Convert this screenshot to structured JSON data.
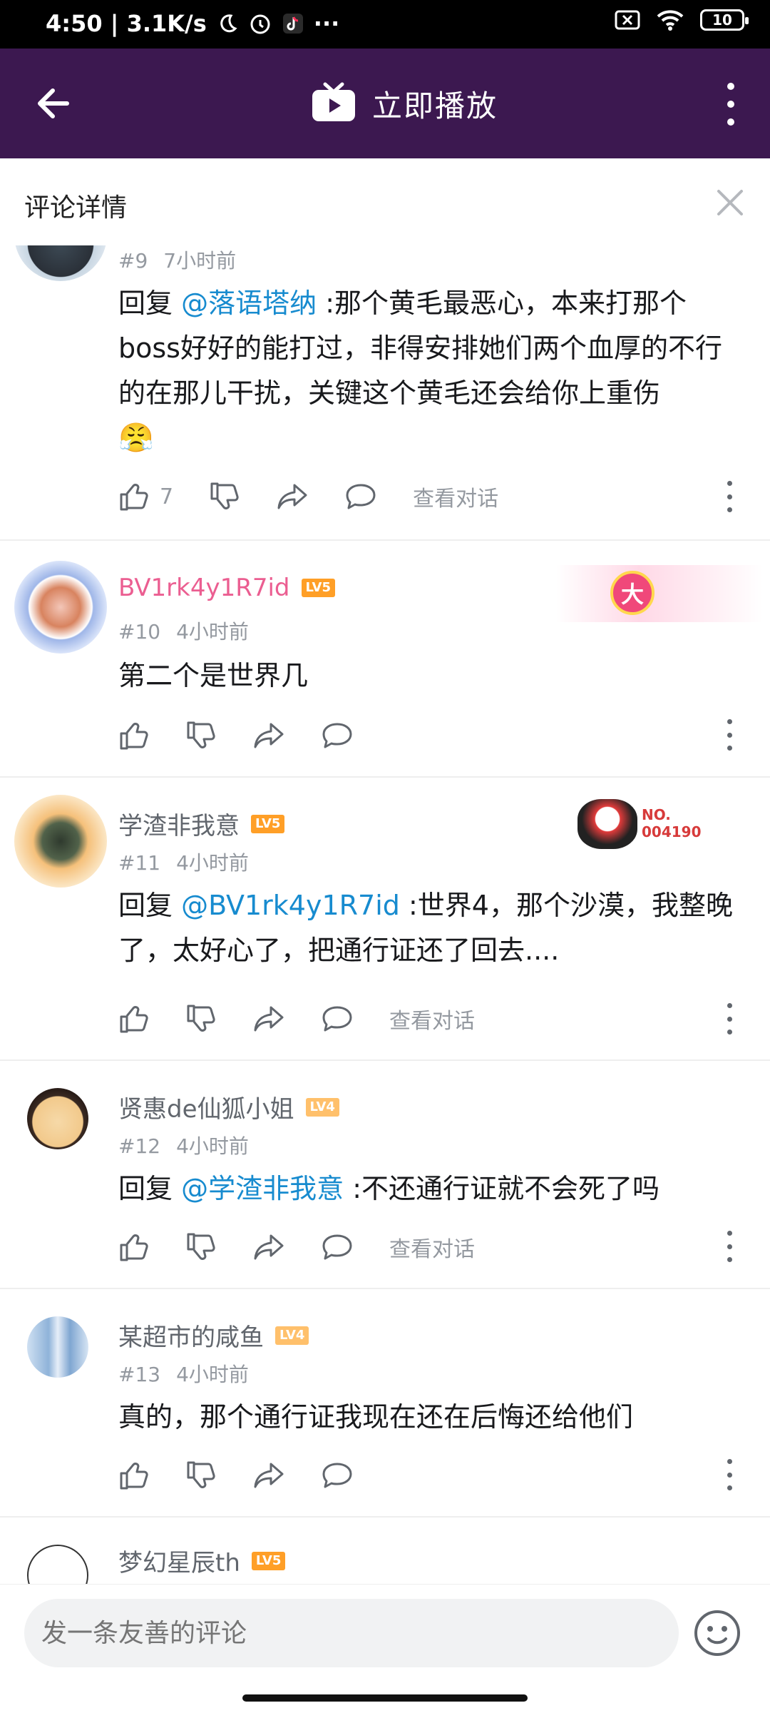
{
  "status_bar": {
    "time_speed": "4:50 | 3.1K/s",
    "more": "···",
    "battery": "10"
  },
  "app_bar": {
    "title": "立即播放"
  },
  "sheet": {
    "title": "评论详情"
  },
  "comments": [
    {
      "floor": "#9",
      "time": "7小时前",
      "reply_prefix": "回复 ",
      "reply_to": "@落语塔纳",
      "text": " :那个黄毛最恶心，本来打那个boss好好的能打过，非得安排她们两个血厚的不行的在那儿干扰，关键这个黄毛还会给你上重伤",
      "emoji": "😤",
      "likes": "7",
      "view_conversation": "查看对话"
    },
    {
      "username": "BV1rk4y1R7id",
      "level": "LV5",
      "floor": "#10",
      "time": "4小时前",
      "text": "第二个是世界几",
      "badge_text": "大"
    },
    {
      "username": "学渣非我意",
      "level": "LV5",
      "floor": "#11",
      "time": "4小时前",
      "reply_prefix": "回复 ",
      "reply_to": "@BV1rk4y1R7id",
      "text": " :世界4，那个沙漠，我整晚了，太好心了，把通行证还了回去....",
      "badge_no": "NO.",
      "badge_num": "004190",
      "view_conversation": "查看对话"
    },
    {
      "username": "贤惠de仙狐小姐",
      "level": "LV4",
      "floor": "#12",
      "time": "4小时前",
      "reply_prefix": "回复 ",
      "reply_to": "@学渣非我意",
      "text": " :不还通行证就不会死了吗",
      "view_conversation": "查看对话"
    },
    {
      "username": "某超市的咸鱼",
      "level": "LV4",
      "floor": "#13",
      "time": "4小时前",
      "text": "真的，那个通行证我现在还在后悔还给他们"
    },
    {
      "username": "梦幻星辰th",
      "level": "LV5"
    }
  ],
  "input": {
    "placeholder": "发一条友善的评论"
  },
  "colors": {
    "app_bar": "#3c1850",
    "link": "#178bcf",
    "vip_name": "#eb5e91",
    "lv5": "#ff9f27",
    "lv4": "#ffc06b"
  }
}
